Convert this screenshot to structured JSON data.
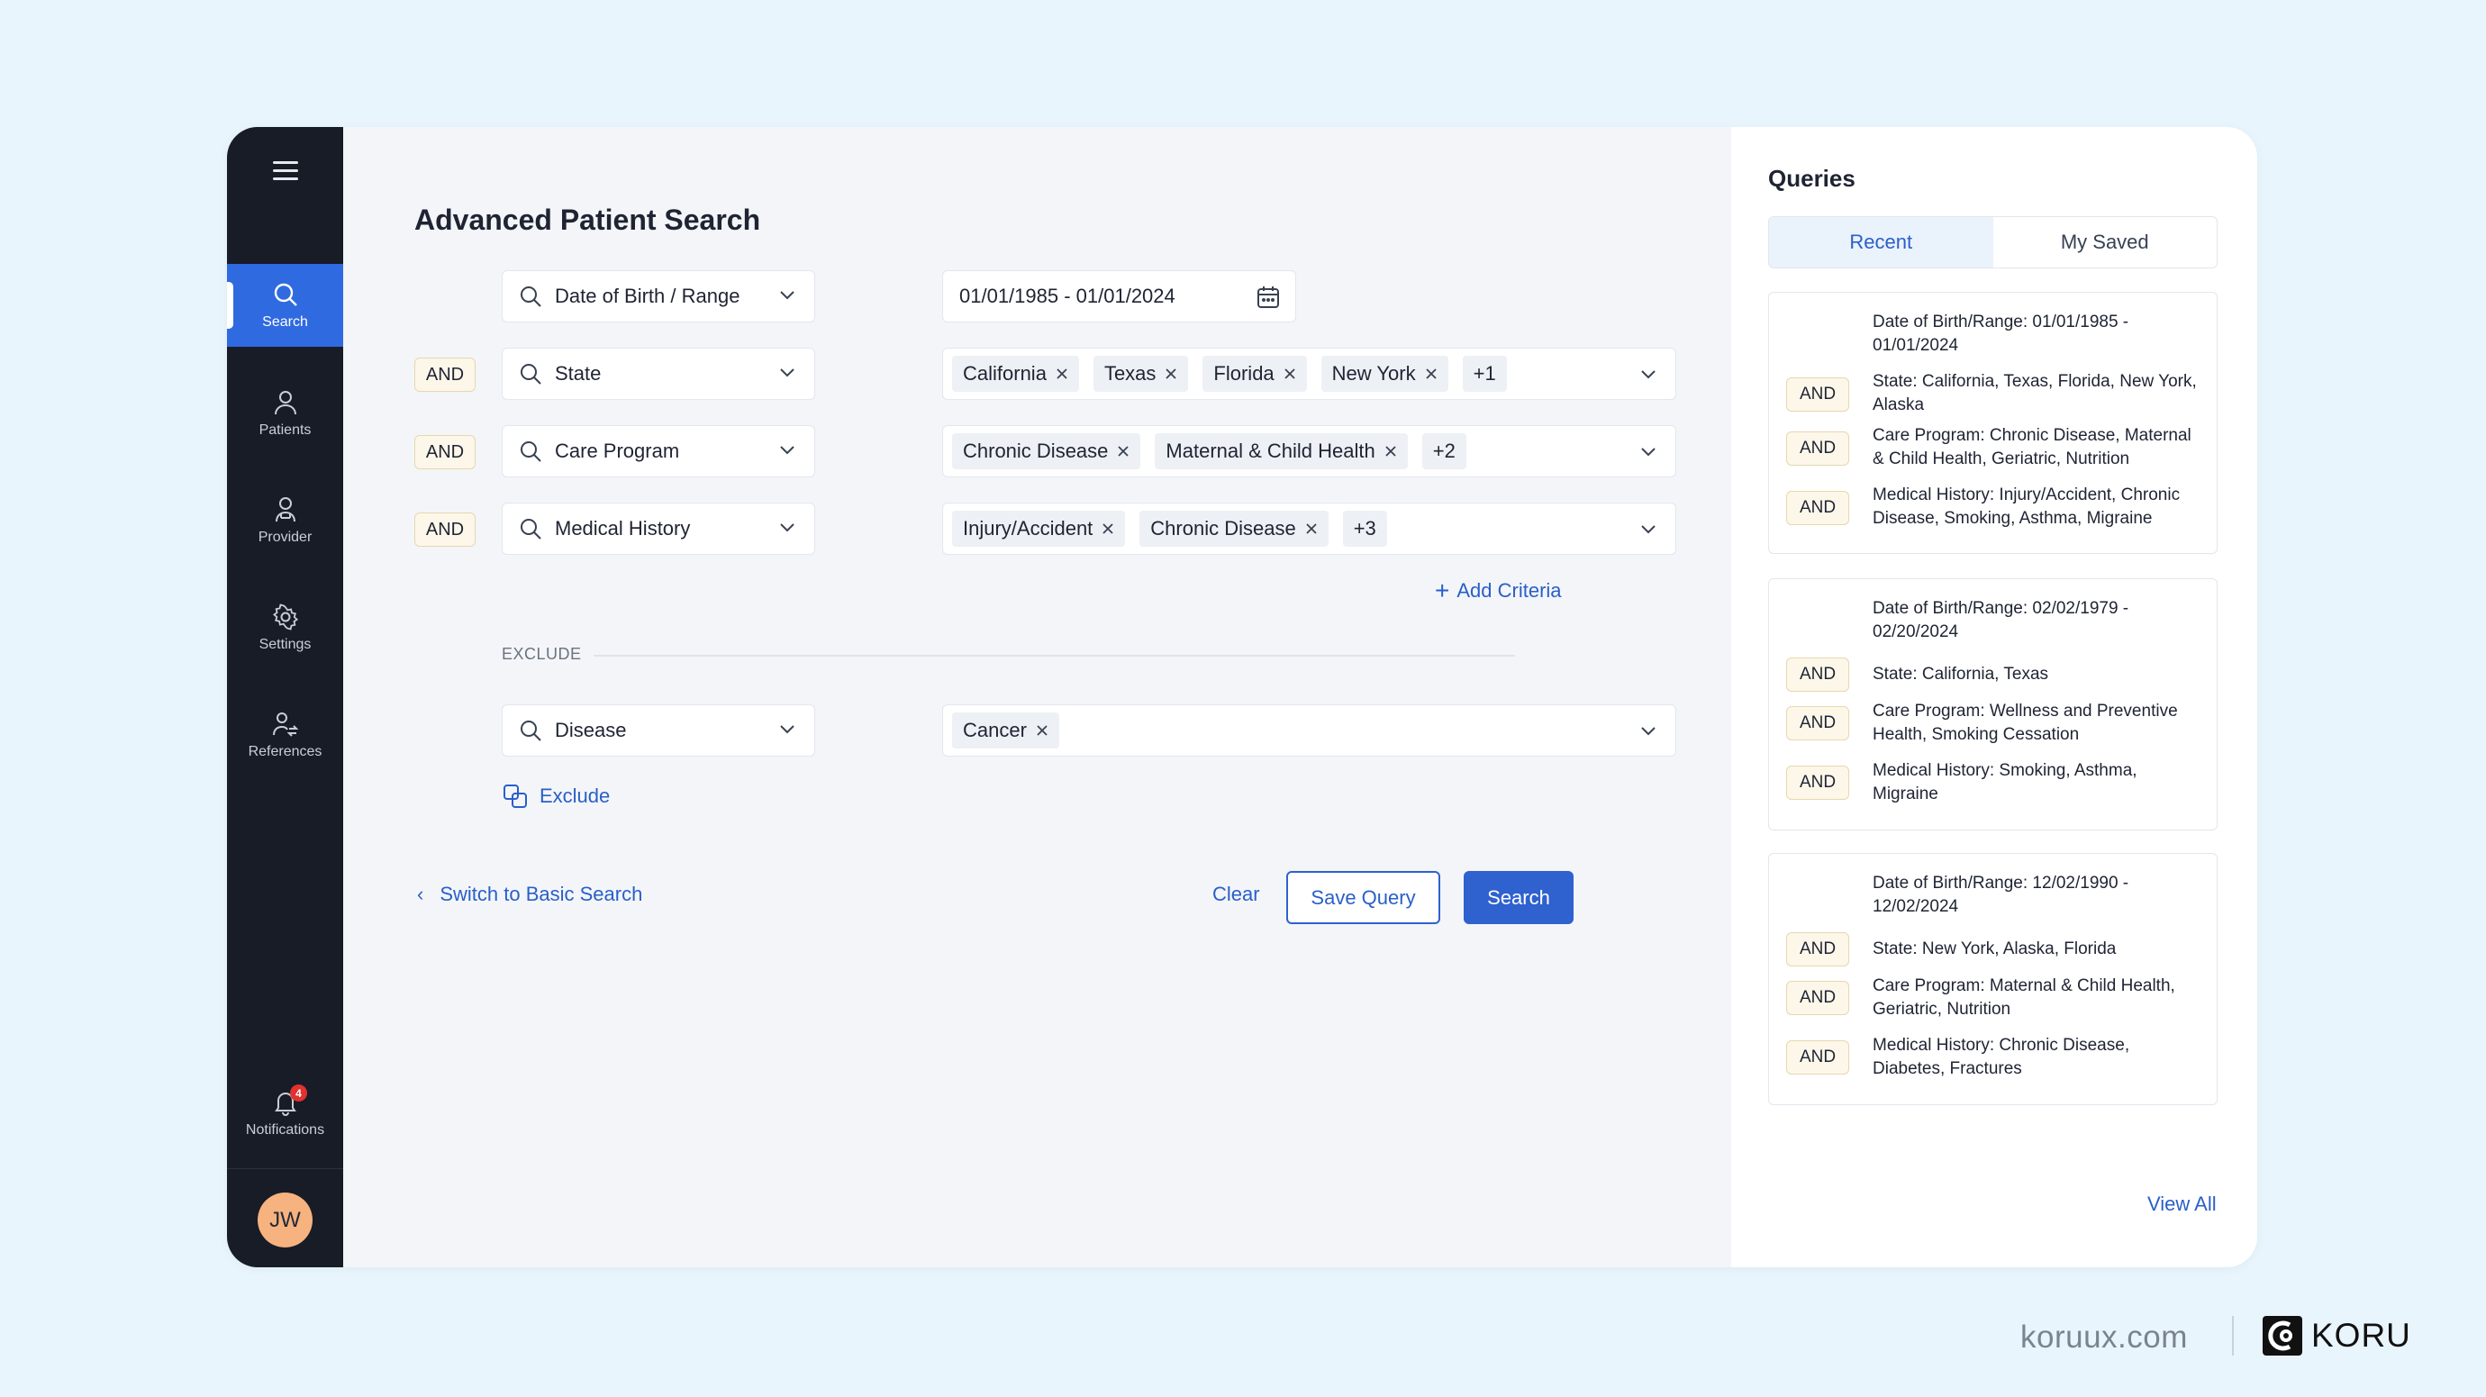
{
  "sidebar": {
    "items": [
      {
        "label": "Search",
        "icon": "search-icon"
      },
      {
        "label": "Patients",
        "icon": "user-icon"
      },
      {
        "label": "Provider",
        "icon": "provider-icon"
      },
      {
        "label": "Settings",
        "icon": "gear-icon"
      },
      {
        "label": "References",
        "icon": "references-icon"
      }
    ],
    "notifications": {
      "label": "Notifications",
      "badge": "4"
    },
    "avatar": "JW"
  },
  "main": {
    "title": "Advanced Patient Search",
    "criteria": [
      {
        "operator": "",
        "field": "Date of Birth / Range",
        "value": "01/01/1985 - 01/01/2024"
      },
      {
        "operator": "AND",
        "field": "State",
        "chips": [
          "California",
          "Texas",
          "Florida",
          "New York"
        ],
        "more": "+1"
      },
      {
        "operator": "AND",
        "field": "Care Program",
        "chips": [
          "Chronic Disease",
          "Maternal & Child Health"
        ],
        "more": "+2"
      },
      {
        "operator": "AND",
        "field": "Medical History",
        "chips": [
          "Injury/Accident",
          "Chronic Disease"
        ],
        "more": "+3"
      }
    ],
    "add_criteria": "Add Criteria",
    "exclude_label": "EXCLUDE",
    "exclude_row": {
      "field": "Disease",
      "chips": [
        "Cancer"
      ]
    },
    "exclude_button": "Exclude",
    "switch_link": "Switch to Basic Search",
    "clear_label": "Clear",
    "save_label": "Save Query",
    "search_label": "Search"
  },
  "queries": {
    "title": "Queries",
    "tabs": [
      "Recent",
      "My Saved"
    ],
    "cards": [
      {
        "dob": "Date of Birth/Range: 01/01/1985 - 01/01/2024",
        "lines": [
          "State: California, Texas, Florida, New York, Alaska",
          "Care Program: Chronic Disease, Maternal & Child Health, Geriatric, Nutrition",
          "Medical History: Injury/Accident, Chronic Disease, Smoking, Asthma, Migraine"
        ]
      },
      {
        "dob": "Date of Birth/Range: 02/02/1979 - 02/20/2024",
        "lines": [
          "State: California, Texas",
          "Care Program: Wellness and Preventive Health, Smoking Cessation",
          "Medical History: Smoking, Asthma, Migraine"
        ]
      },
      {
        "dob": "Date of Birth/Range: 12/02/1990 - 12/02/2024",
        "lines": [
          "State: New York, Alaska, Florida",
          "Care Program: Maternal & Child Health, Geriatric, Nutrition",
          "Medical History: Chronic Disease, Diabetes, Fractures"
        ]
      }
    ],
    "and_label": "AND",
    "view_all": "View All"
  },
  "brand": {
    "url": "koruux.com",
    "name": "KORU"
  },
  "colors": {
    "primary": "#2f61cf",
    "sidebar": "#171c27",
    "background": "#e9f5fc",
    "and_tag": "#fdf7ea"
  }
}
